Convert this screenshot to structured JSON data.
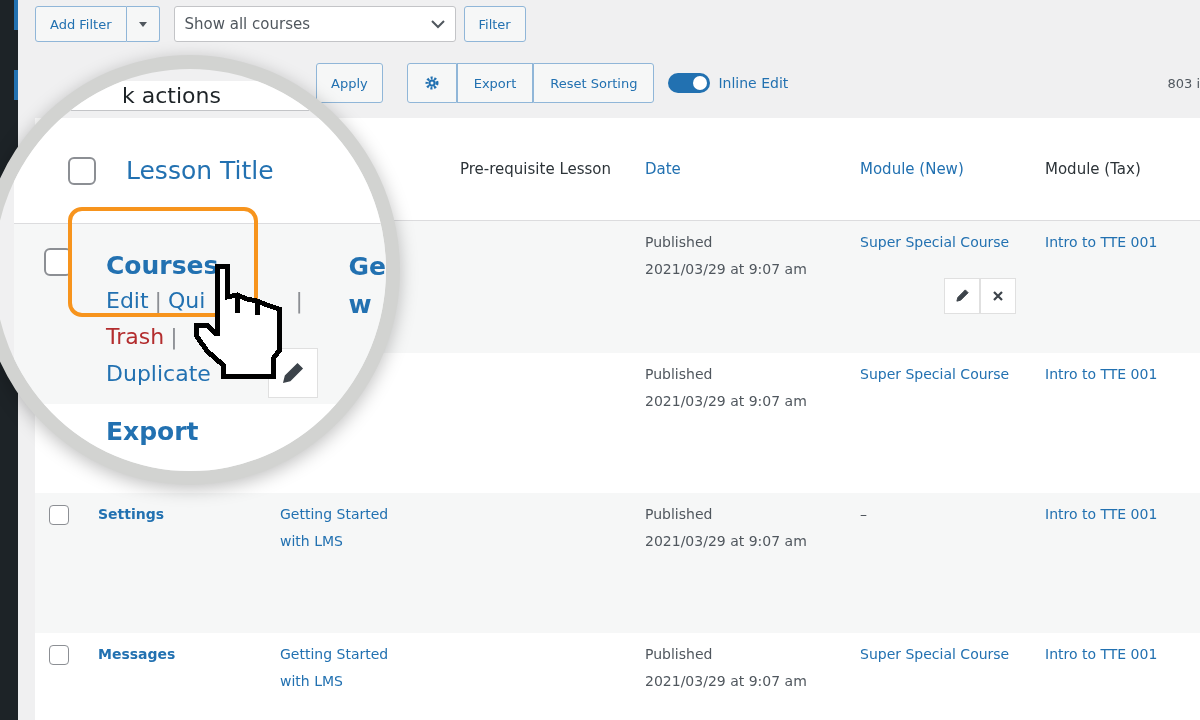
{
  "toolbar": {
    "add_filter": "Add Filter",
    "filter_select": "Show all courses",
    "filter_button": "Filter",
    "apply": "Apply",
    "button_group": [
      "Export",
      "Reset Sorting"
    ],
    "inline_edit": {
      "label": "Inline Edit",
      "on": true
    },
    "items_count": "803 i"
  },
  "table": {
    "columns": [
      {
        "label": "Lesson Title",
        "sortable": true
      },
      {
        "label": "Pre-requisite Lesson",
        "sortable": false
      },
      {
        "label": "Date",
        "sortable": true
      },
      {
        "label": "Module (New)",
        "sortable": true
      },
      {
        "label": "Module (Tax)",
        "sortable": false
      }
    ],
    "rows": [
      {
        "status": "Published",
        "date": "2021/03/29 at 9:07 am",
        "module_new": "Super Special Course",
        "module_tax": "Intro to TTE 001",
        "hovered": true
      },
      {
        "status": "Published",
        "date": "2021/03/29 at 9:07 am",
        "module_new": "Super Special Course",
        "module_tax": "Intro to TTE 001",
        "hovered": false
      },
      {
        "checked": false,
        "title": "Settings",
        "course": "Getting Started with LMS",
        "status": "Published",
        "date": "2021/03/29 at 9:07 am",
        "module_new": "–",
        "module_tax": "Intro to TTE 001",
        "hovered": false
      },
      {
        "checked": false,
        "title": "Messages",
        "course": "Getting Started with LMS",
        "status": "Published",
        "date": "2021/03/29 at 9:07 am",
        "module_new": "Super Special Course",
        "module_tax": "Intro to TTE 001",
        "hovered": false
      }
    ]
  },
  "magnifier": {
    "bulk_field": "k actions",
    "header_checked": false,
    "rows": [
      {
        "checked": false,
        "title": "Courses",
        "highlighted": true,
        "hovered": true,
        "fragments": [
          "Ge",
          "w"
        ],
        "actions": [
          [
            {
              "text": "Edit",
              "kind": "link"
            },
            {
              "text": "|",
              "kind": "sep"
            },
            {
              "text": "Qui",
              "kind": "link"
            },
            {
              "text": "|",
              "kind": "far-sep"
            }
          ],
          [
            {
              "text": "Trash",
              "kind": "danger"
            },
            {
              "text": "|",
              "kind": "sep"
            }
          ],
          [
            {
              "text": "Duplicate",
              "kind": "link"
            }
          ]
        ]
      },
      {
        "title": "Export",
        "fragments": [],
        "actions": []
      }
    ]
  }
}
